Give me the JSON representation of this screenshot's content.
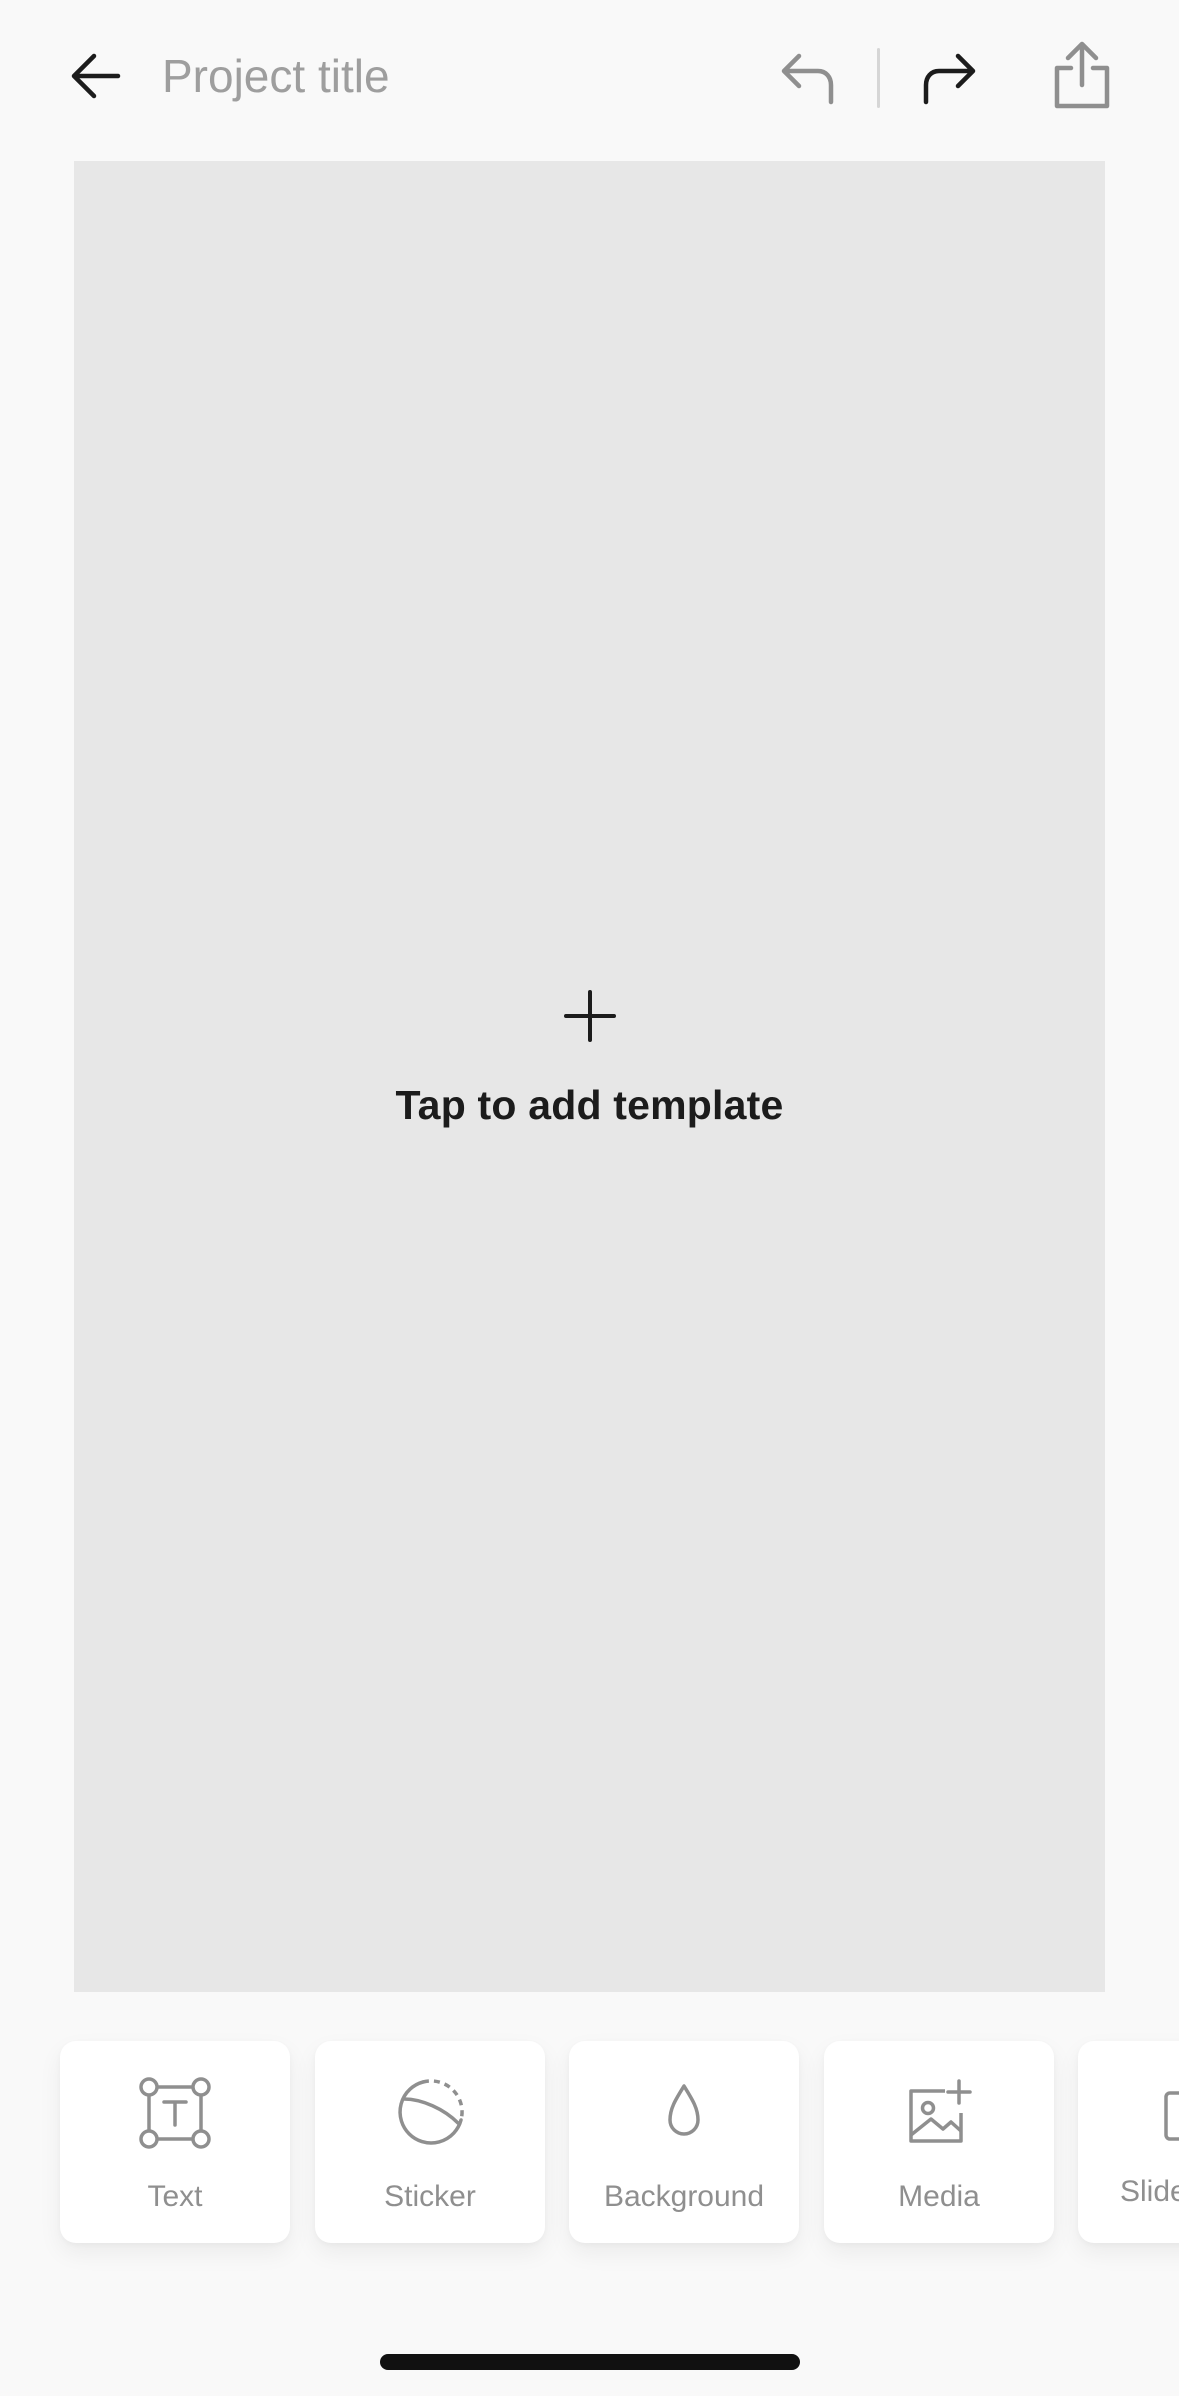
{
  "header": {
    "back_icon": "arrow-left-icon",
    "title_placeholder": "Project title",
    "title_value": "",
    "undo_icon": "undo-icon",
    "redo_icon": "redo-icon",
    "share_icon": "share-icon"
  },
  "canvas": {
    "add_icon": "plus-icon",
    "add_label": "Tap to add template"
  },
  "toolbar": {
    "items": [
      {
        "label": "Text",
        "icon": "text-box-icon"
      },
      {
        "label": "Sticker",
        "icon": "sticker-icon"
      },
      {
        "label": "Background",
        "icon": "droplet-icon"
      },
      {
        "label": "Media",
        "icon": "image-add-icon"
      },
      {
        "label": "Slide",
        "icon": "slide-icon"
      }
    ]
  },
  "colors": {
    "page_background": "#f9f9f9",
    "canvas_background": "#e7e7e7",
    "primary_text": "#1c1c1c",
    "muted_text": "#8f8f8f",
    "placeholder_text": "#9e9e9e"
  }
}
